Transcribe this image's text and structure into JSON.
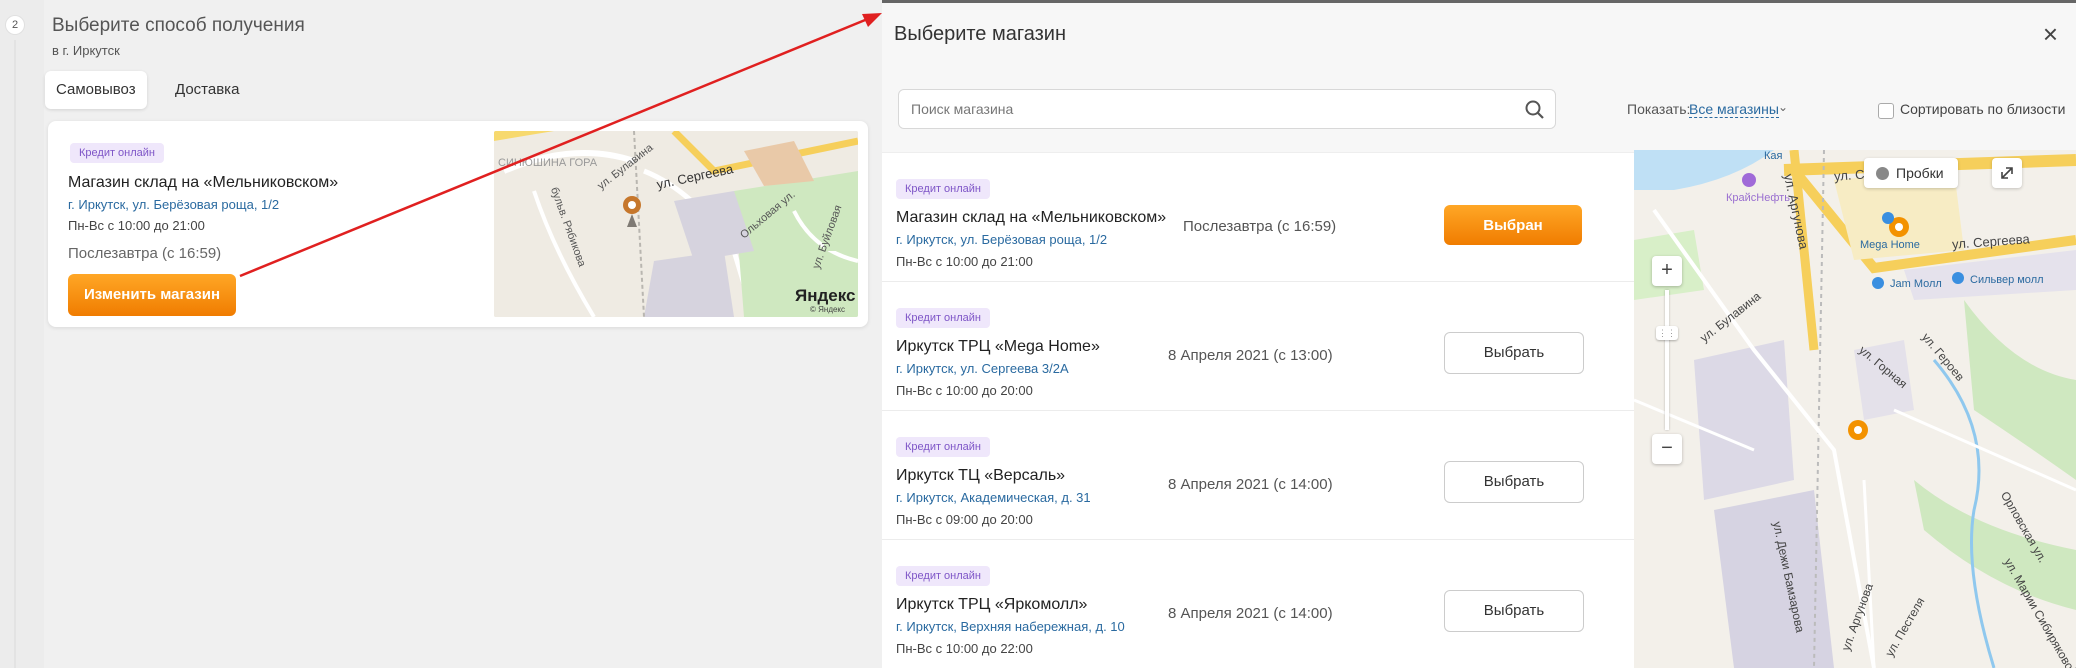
{
  "left": {
    "step_number": "2",
    "title": "Выберите способ получения",
    "city": "в г. Иркутск",
    "tabs": [
      {
        "label": "Самовывоз",
        "active": true
      },
      {
        "label": "Доставка",
        "active": false
      }
    ],
    "store": {
      "badge": "Кредит онлайн",
      "name": "Магазин склад на «Мельниковском»",
      "address": "г. Иркутск, ул. Берёзовая роща, 1/2",
      "hours": "Пн-Вс с 10:00 до 21:00",
      "delivery": "Послезавтра (с 16:59)",
      "change_button": "Изменить магазин"
    },
    "mini_map": {
      "labels": [
        "СИНЮШИНА ГОРА",
        "ул. Булавина",
        "ул. Сергеева",
        "бульв. Рябикова",
        "Ольховая ул.",
        "ул. Буйловая"
      ],
      "brand": "Яндекс",
      "brand_sub": "© Яндекс"
    }
  },
  "modal": {
    "title": "Выберите магазин",
    "close_icon": "×",
    "search_placeholder": "Поиск магазина",
    "show_label": "Показать:",
    "show_value": "Все магазины",
    "sort_label": "Сортировать по близости",
    "stores": [
      {
        "badge": "Кредит онлайн",
        "name": "Магазин склад на «Мельниковском»",
        "address": "г. Иркутск, ул. Берёзовая роща, 1/2",
        "hours": "Пн-Вс с 10:00 до 21:00",
        "date": "Послезавтра (с 16:59)",
        "button": "Выбран",
        "selected": true
      },
      {
        "badge": "Кредит онлайн",
        "name": "Иркутск ТРЦ «Mega Home»",
        "address": "г. Иркутск, ул. Сергеева 3/2А",
        "hours": "Пн-Вс с 10:00 до 20:00",
        "date": "8 Апреля 2021 (с 13:00)",
        "button": "Выбрать",
        "selected": false
      },
      {
        "badge": "Кредит онлайн",
        "name": "Иркутск ТЦ «Версаль»",
        "address": "г. Иркутск, Академическая, д. 31",
        "hours": "Пн-Вс с 09:00 до 20:00",
        "date": "8 Апреля 2021 (с 14:00)",
        "button": "Выбрать",
        "selected": false
      },
      {
        "badge": "Кредит онлайн",
        "name": "Иркутск ТРЦ «Яркомолл»",
        "address": "г. Иркутск, Верхняя набережная, д. 10",
        "hours": "Пн-Вс с 10:00 до 22:00",
        "date": "8 Апреля 2021 (с 14:00)",
        "button": "Выбрать",
        "selected": false
      }
    ],
    "map": {
      "traffic_label": "Пробки",
      "zoom_in": "+",
      "zoom_out": "−",
      "street_labels": [
        "ул. Сергеева",
        "ул. Сергеева",
        "ул. Аргунова",
        "ул. Булавина",
        "ул. Аргунова",
        "ул. Пестеля",
        "ул. Героев",
        "ул. Дежи Бамзарова",
        "Орловская ул.",
        "ул. Марии Сибиряковой",
        "ул. Горная"
      ],
      "pois": [
        "КрайсНефть",
        "Mega Home",
        "Jam Молл",
        "Сильвер молл",
        "Кая"
      ]
    }
  },
  "colors": {
    "accent_orange": "#f39200",
    "link_blue": "#2a6aa0",
    "badge_bg": "#efe7fb",
    "badge_text": "#7e55c7",
    "annotation_red": "#e02020"
  }
}
